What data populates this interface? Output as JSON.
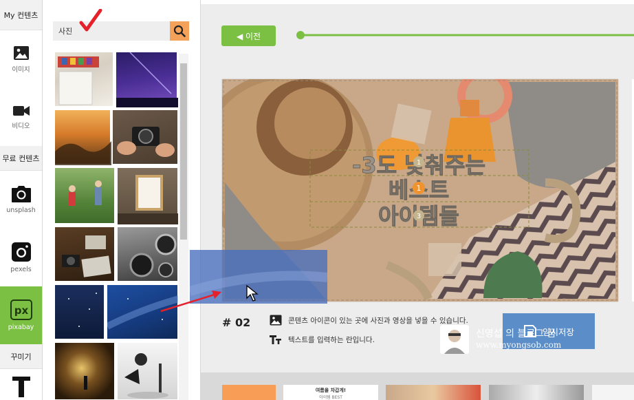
{
  "rail": {
    "my_contents": "My 컨텐츠",
    "image": "이미지",
    "video": "비디오",
    "free_contents": "무료 컨텐츠",
    "unsplash": "unsplash",
    "pexels": "pexels",
    "pixabay": "pixabay",
    "decorate": "꾸미기"
  },
  "search": {
    "value": "사진"
  },
  "editor": {
    "prev_label": "◀ 이전",
    "slide_number": "# 02",
    "help_image": "콘텐츠 아이콘이 있는 곳에 사진과 영상을 넣을 수 있습니다.",
    "help_text": "텍스트를 입력하는 란입니다.",
    "save_label": "임시저장",
    "canvas_text": [
      "-3도 낮춰주는",
      "베스트",
      "아이템들"
    ],
    "text_markers": [
      "1",
      "1",
      "3"
    ],
    "bottom_thumb_text_1": "여름을 차갑게!",
    "bottom_thumb_text_2": "아이템 BEST"
  },
  "watermark": {
    "name": "신영섭 의 블로그 꿈",
    "url": "www.myongsob.com"
  },
  "colors": {
    "accent_green": "#7bc043",
    "search_orange": "#f4a259",
    "save_blue": "#5b8dc8"
  }
}
